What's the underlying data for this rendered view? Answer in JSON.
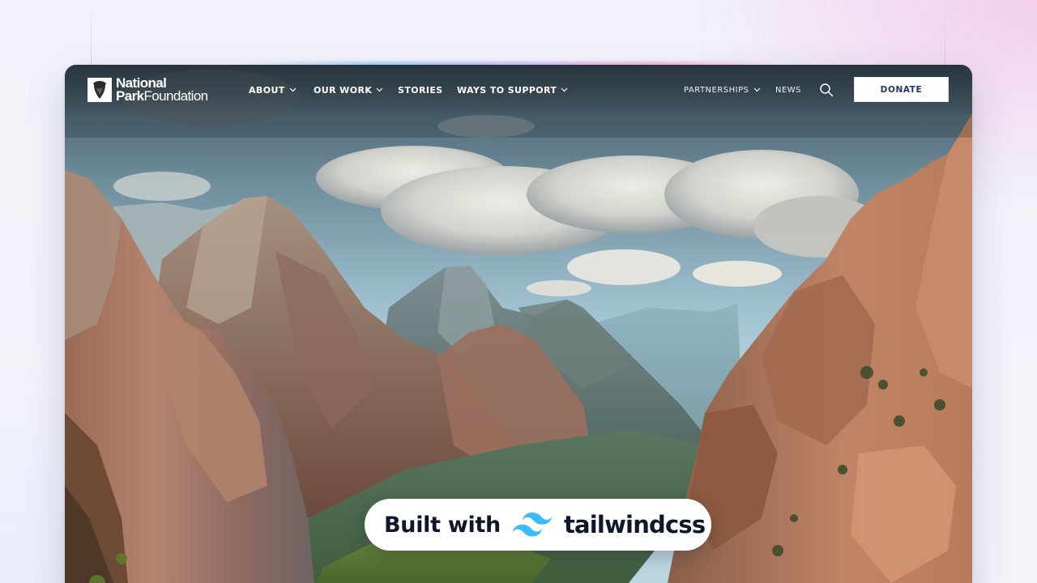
{
  "brand": {
    "logo_line1": "National",
    "logo_line2_bold": "Park",
    "logo_line2_rest": "Foundation",
    "logo_icon": "arrowhead-icon"
  },
  "nav": {
    "primary": [
      {
        "label": "ABOUT",
        "has_dropdown": true
      },
      {
        "label": "OUR WORK",
        "has_dropdown": true
      },
      {
        "label": "STORIES",
        "has_dropdown": false
      },
      {
        "label": "WAYS TO SUPPORT",
        "has_dropdown": true
      }
    ],
    "secondary": [
      {
        "label": "PARTNERSHIPS",
        "has_dropdown": true
      },
      {
        "label": "NEWS",
        "has_dropdown": false
      }
    ],
    "search_icon": "search-icon",
    "donate_label": "DONATE"
  },
  "hero": {
    "image_subject": "canyon-landscape"
  },
  "badge": {
    "built_with": "Built with",
    "brand_name": "tailwindcss",
    "brand_icon": "tailwind-logo-icon",
    "brand_color": "#38bdf8"
  },
  "colors": {
    "donate_text": "#1f3a5c",
    "badge_text": "#0f172a"
  }
}
